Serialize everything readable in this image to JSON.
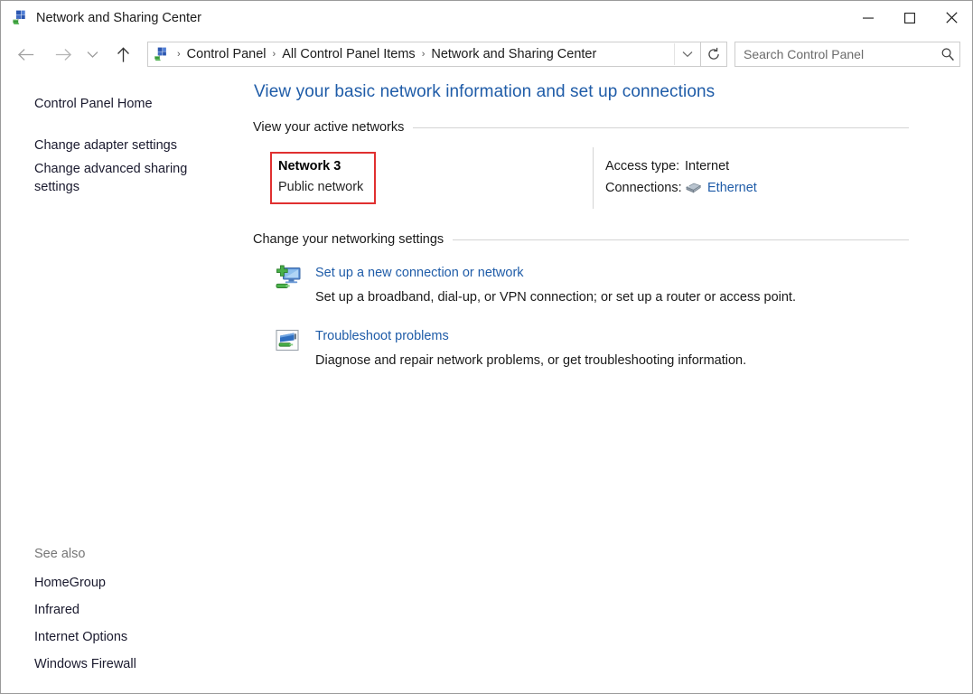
{
  "window": {
    "title": "Network and Sharing Center",
    "title_icon": "network-sharing-icon",
    "minimize_label": "Minimize",
    "maximize_label": "Maximize",
    "close_label": "Close"
  },
  "nav": {
    "back_label": "Back",
    "forward_label": "Forward",
    "recent_label": "Recent locations",
    "up_label": "Up one level",
    "address_icon": "network-sharing-icon",
    "breadcrumbs": [
      "Control Panel",
      "All Control Panel Items",
      "Network and Sharing Center"
    ],
    "separator": "›",
    "dropdown_label": "Previous locations",
    "refresh_label": "Refresh"
  },
  "search": {
    "placeholder": "Search Control Panel",
    "value": "",
    "icon": "search-icon"
  },
  "sidebar": {
    "home": "Control Panel Home",
    "items": [
      "Change adapter settings",
      "Change advanced sharing settings"
    ],
    "see_also_title": "See also",
    "see_also": [
      "HomeGroup",
      "Infrared",
      "Internet Options",
      "Windows Firewall"
    ]
  },
  "main": {
    "heading": "View your basic network information and set up connections",
    "active_section_title": "View your active networks",
    "network": {
      "name": "Network  3",
      "type": "Public network",
      "highlighted": true,
      "highlight_color": "#e03030",
      "details": [
        {
          "key": "Access type:",
          "value": "Internet",
          "is_link": false,
          "icon": ""
        },
        {
          "key": "Connections:",
          "value": "Ethernet",
          "is_link": true,
          "icon": "ethernet-icon"
        }
      ]
    },
    "change_section_title": "Change your networking settings",
    "tasks": [
      {
        "icon": "new-connection-icon",
        "title": "Set up a new connection or network",
        "description": "Set up a broadband, dial-up, or VPN connection; or set up a router or access point."
      },
      {
        "icon": "troubleshoot-icon",
        "title": "Troubleshoot problems",
        "description": "Diagnose and repair network problems, or get troubleshooting information."
      }
    ]
  },
  "colors": {
    "link": "#1f5ca8",
    "heading": "#1f5ca8",
    "highlight": "#e03030",
    "rule": "#d4d4d4"
  }
}
